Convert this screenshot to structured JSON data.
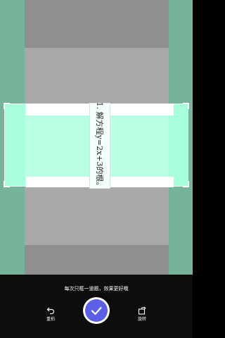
{
  "crop": {
    "question_text": "1. 解方程y=2x+3的根。"
  },
  "bottom_bar": {
    "hint": "每次只框一道题，效果更好哦",
    "retake_label": "重拍",
    "rotate_label": "旋转",
    "retake_icon": "undo-icon",
    "confirm_icon": "checkmark-icon",
    "rotate_icon": "rotate-icon"
  },
  "colors": {
    "accent": "#5b5fe6",
    "crop_fill": "#b8ffe4",
    "side_strip": "#76b39a"
  }
}
